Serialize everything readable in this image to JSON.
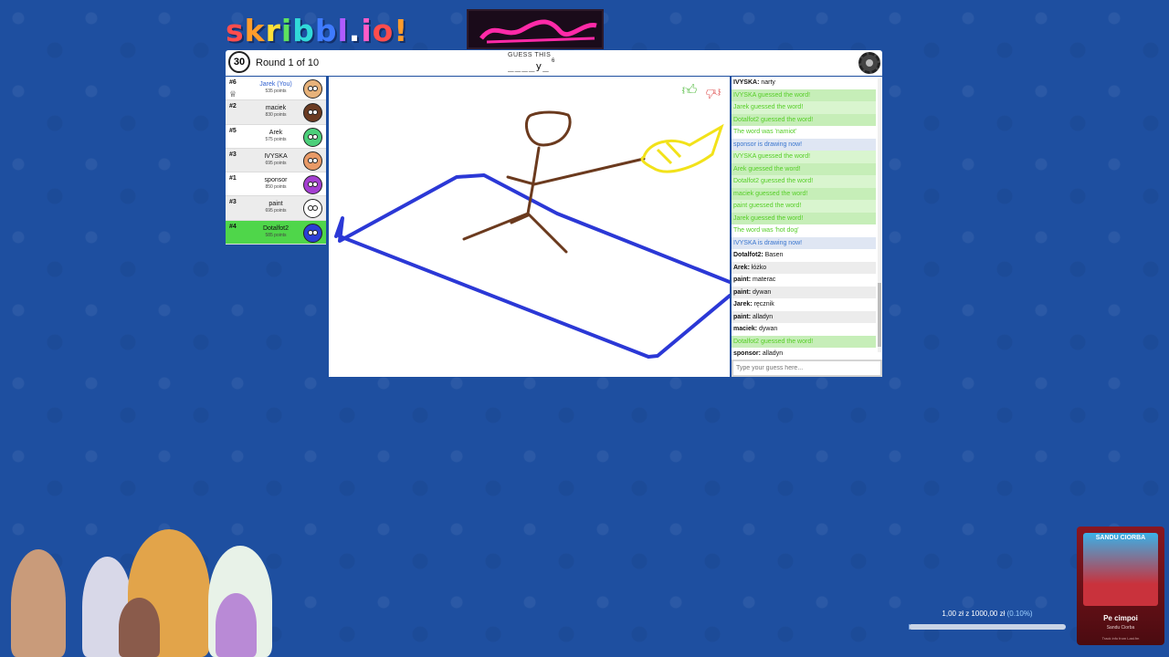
{
  "logo": {
    "letters": [
      "s",
      "k",
      "r",
      "i",
      "b",
      "b",
      "l",
      ".",
      "i",
      "o",
      "!"
    ],
    "colors": [
      "#ff4d4d",
      "#ff9c2b",
      "#ffe138",
      "#5ee35e",
      "#31d9d9",
      "#3f7bff",
      "#b05cff",
      "#ffffff",
      "#ff5cc8",
      "#ff4d4d",
      "#ff9c2b"
    ]
  },
  "header": {
    "timer": "30",
    "round": "Round 1 of 10",
    "guess_label": "GUESS THIS",
    "hint": "____y_",
    "hint_count": "6"
  },
  "players": [
    {
      "rank": "#6",
      "name": "Jarek (You)",
      "points": "535 points",
      "you": true,
      "crown": true,
      "avatar_color": "#e7b27a"
    },
    {
      "rank": "#2",
      "name": "maciek",
      "points": "830 points",
      "avatar_color": "#6b3b22"
    },
    {
      "rank": "#5",
      "name": "Arek",
      "points": "575 points",
      "avatar_color": "#4ccf7a"
    },
    {
      "rank": "#3",
      "name": "IVYSKA",
      "points": "695 points",
      "avatar_color": "#e89a67"
    },
    {
      "rank": "#1",
      "name": "sponsor",
      "points": "850 points",
      "avatar_color": "#a43fd1"
    },
    {
      "rank": "#3",
      "name": "paint",
      "points": "695 points",
      "avatar_color": "#ffffff"
    },
    {
      "rank": "#4",
      "name": "Dotalfot2",
      "points": "585 points",
      "highlight": true,
      "avatar_color": "#2b3fd6"
    }
  ],
  "chat": [
    {
      "name": "IVYSKA",
      "text": "narty",
      "type": "msg"
    },
    {
      "text": "IVYSKA guessed the word!",
      "type": "guessed"
    },
    {
      "text": "Jarek guessed the word!",
      "type": "guessed"
    },
    {
      "text": "Dotalfot2 guessed the word!",
      "type": "guessed"
    },
    {
      "text": "The word was 'namiot'",
      "type": "word"
    },
    {
      "text": "sponsor is drawing now!",
      "type": "drawing"
    },
    {
      "text": "IVYSKA guessed the word!",
      "type": "guessed"
    },
    {
      "text": "Arek guessed the word!",
      "type": "guessed"
    },
    {
      "text": "Dotalfot2 guessed the word!",
      "type": "guessed"
    },
    {
      "text": "maciek guessed the word!",
      "type": "guessed"
    },
    {
      "text": "paint guessed the word!",
      "type": "guessed"
    },
    {
      "text": "Jarek guessed the word!",
      "type": "guessed"
    },
    {
      "text": "The word was 'hot dog'",
      "type": "word"
    },
    {
      "text": "IVYSKA is drawing now!",
      "type": "drawing"
    },
    {
      "name": "Dotalfot2",
      "text": "Basen",
      "type": "msg"
    },
    {
      "name": "Arek",
      "text": "łóżko",
      "type": "msg"
    },
    {
      "name": "paint",
      "text": "materac",
      "type": "msg"
    },
    {
      "name": "paint",
      "text": "dywan",
      "type": "msg"
    },
    {
      "name": "Jarek",
      "text": "ręcznik",
      "type": "msg"
    },
    {
      "name": "paint",
      "text": "alladyn",
      "type": "msg"
    },
    {
      "name": "maciek",
      "text": "dywan",
      "type": "msg"
    },
    {
      "text": "Dotalfot2 guessed the word!",
      "type": "guessed"
    },
    {
      "name": "sponsor",
      "text": "alladyn",
      "type": "msg"
    }
  ],
  "chat_input": {
    "placeholder": "Type your guess here..."
  },
  "donation": {
    "amount_text": "1,00 zł z 1000,00 zł",
    "percent_text": "(0.10%)",
    "fraction": 0.001
  },
  "music": {
    "artist_top": "SANDU CIORBA",
    "title": "Pe cimpoi",
    "artist": "Sandu Ciorba",
    "footer": "Track info from Last.fm"
  },
  "icons": {
    "thumbs_up": "thumbs-up-icon",
    "thumbs_down": "thumbs-down-icon",
    "gear": "gear-icon",
    "clock": "clock-icon",
    "crown": "crown-icon",
    "pencil": "pencil-icon"
  }
}
